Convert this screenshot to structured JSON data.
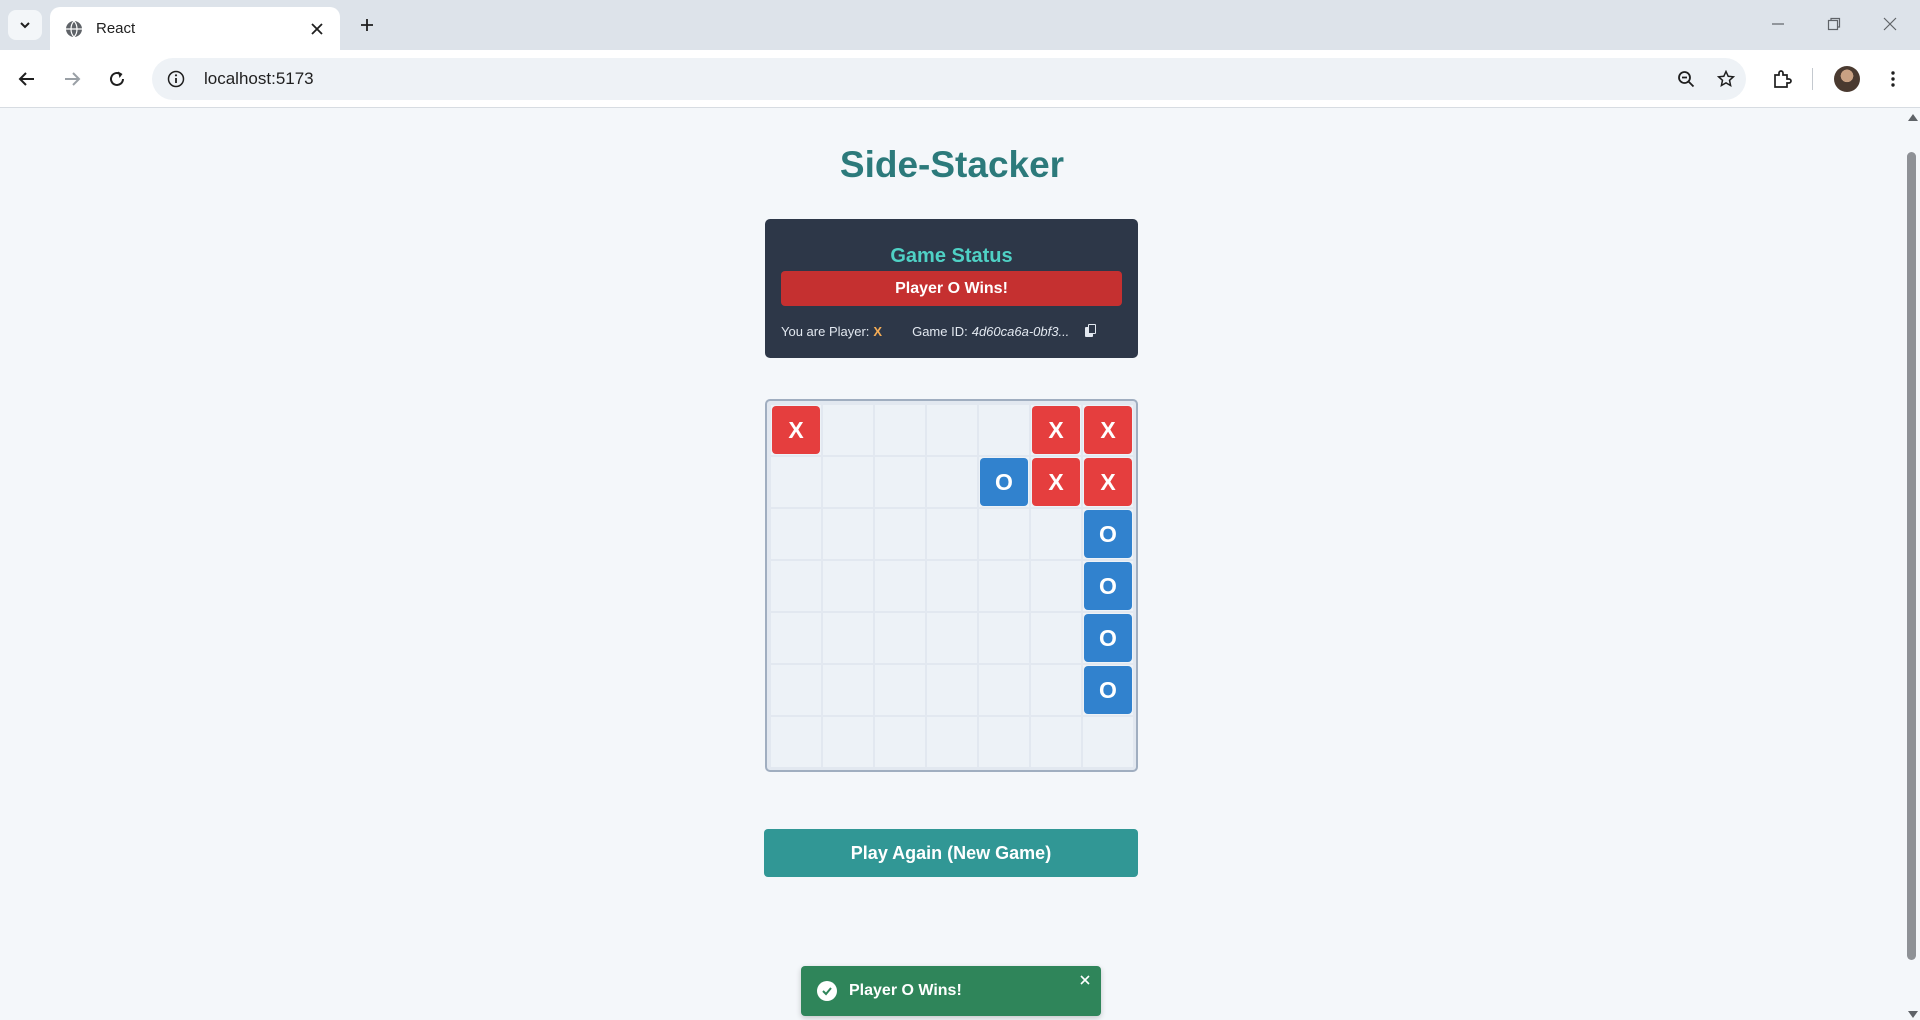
{
  "browser": {
    "tab_title": "React",
    "url": "localhost:5173"
  },
  "game": {
    "title": "Side-Stacker",
    "status_heading": "Game Status",
    "status_message": "Player O Wins!",
    "player_label": "You are Player:",
    "player_value": "X",
    "game_id_label": "Game ID:",
    "game_id_value": "4d60ca6a-0bf3...",
    "board": [
      [
        "X",
        "",
        "",
        "",
        "",
        "X",
        "X"
      ],
      [
        "",
        "",
        "",
        "",
        "O",
        "X",
        "X"
      ],
      [
        "",
        "",
        "",
        "",
        "",
        "",
        "O"
      ],
      [
        "",
        "",
        "",
        "",
        "",
        "",
        "O"
      ],
      [
        "",
        "",
        "",
        "",
        "",
        "",
        "O"
      ],
      [
        "",
        "",
        "",
        "",
        "",
        "",
        "O"
      ],
      [
        "",
        "",
        "",
        "",
        "",
        "",
        ""
      ]
    ],
    "play_again_label": "Play Again (New Game)"
  },
  "toast": {
    "message": "Player O Wins!"
  },
  "colors": {
    "title": "#2c7a7b",
    "card_bg": "#2d3748",
    "heading_accent": "#4fd1c5",
    "win_banner": "#c53030",
    "piece_x": "#e53e3e",
    "piece_o": "#3182ce",
    "play_again": "#319795",
    "toast": "#2f855a"
  }
}
